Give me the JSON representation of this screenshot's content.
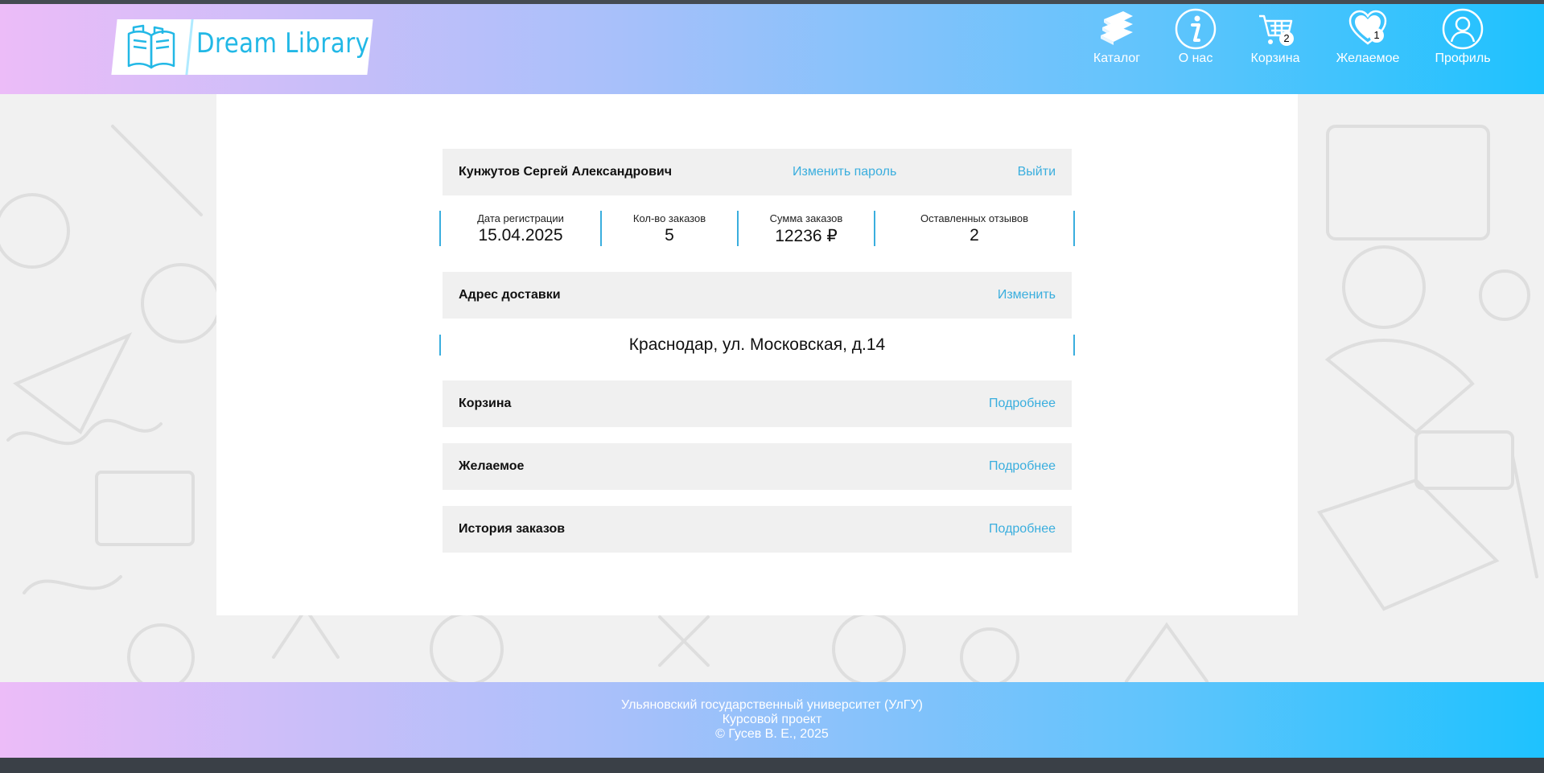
{
  "header": {
    "logo_text": "Dream Library",
    "nav": [
      {
        "label": "Каталог",
        "icon": "books-icon"
      },
      {
        "label": "О нас",
        "icon": "info-icon"
      },
      {
        "label": "Корзина",
        "icon": "cart-icon",
        "badge": "2"
      },
      {
        "label": "Желаемое",
        "icon": "heart-icon",
        "badge": "1"
      },
      {
        "label": "Профиль",
        "icon": "user-icon"
      }
    ]
  },
  "profile": {
    "name": "Кунжутов Сергей Александрович",
    "change_password": "Изменить пароль",
    "logout": "Выйти",
    "stats": [
      {
        "label": "Дата регистрации",
        "value": "15.04.2025"
      },
      {
        "label": "Кол-во заказов",
        "value": "5"
      },
      {
        "label": "Сумма заказов",
        "value": "12236 ₽"
      },
      {
        "label": "Оставленных отзывов",
        "value": "2"
      }
    ],
    "address_title": "Адрес доставки",
    "address_edit": "Изменить",
    "address": "Краснодар, ул. Московская, д.14",
    "sections": [
      {
        "title": "Корзина",
        "link": "Подробнее"
      },
      {
        "title": "Желаемое",
        "link": "Подробнее"
      },
      {
        "title": "История заказов",
        "link": "Подробнее"
      }
    ]
  },
  "footer": {
    "line1": "Ульяновский государственный университет (УлГУ)",
    "line2": "Курсовой проект",
    "line3": "© Гусев В. Е., 2025"
  },
  "colors": {
    "accent": "#3aaede",
    "card_bg": "#f0f0f0",
    "gradient_start": "#ecbcf8",
    "gradient_end": "#1ec2fe"
  }
}
